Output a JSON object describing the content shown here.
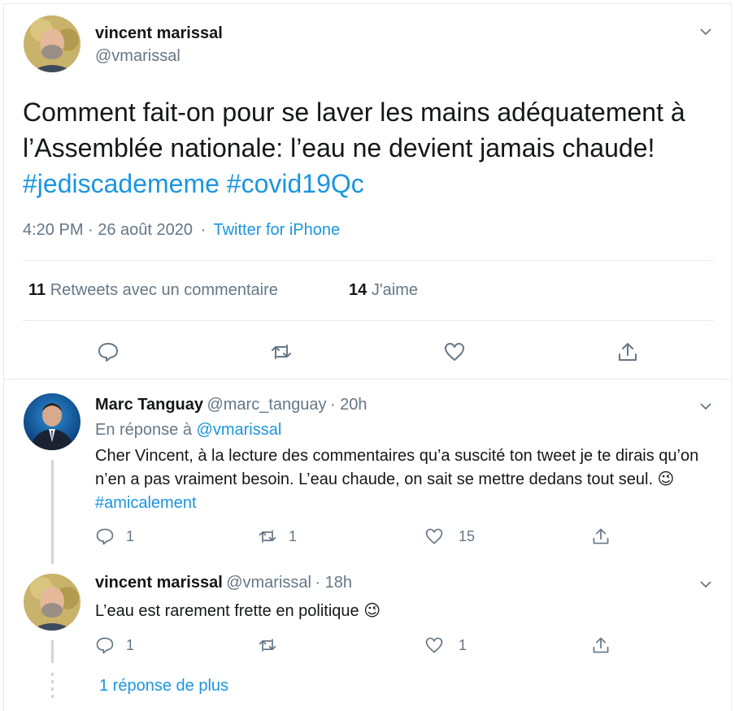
{
  "main_tweet": {
    "name": "vincent marissal",
    "handle": "@vmarissal",
    "text_plain": "Comment fait-on pour se laver les mains adéquatement à l’Assemblée nationale: l’eau ne devient jamais chaude! ",
    "hashtags": [
      "#jediscadememe",
      "#covid19Qc"
    ],
    "timestamp": "4:20 PM · 26 août 2020",
    "separator": "·",
    "source": "Twitter for iPhone",
    "retweet_count": "11",
    "retweet_label": "Retweets avec un commentaire",
    "like_count": "14",
    "like_label": "J'aime"
  },
  "reply1": {
    "name": "Marc Tanguay",
    "handle": "@marc_tanguay",
    "time": "· 20h",
    "reply_prefix": "En réponse à",
    "reply_to": "@vmarissal",
    "text": "Cher Vincent, à la lecture des commentaires qu’a suscité ton tweet je te dirais qu’on n’en a pas vraiment besoin. L’eau chaude, on sait se mettre dedans tout seul. 😉",
    "hashtag": "#amicalement",
    "reply_count": "1",
    "retweet_count": "1",
    "like_count": "15"
  },
  "reply2": {
    "name": "vincent marissal",
    "handle": "@vmarissal",
    "time": "· 18h",
    "text": "L’eau est rarement frette en politique 😉",
    "reply_count": "1",
    "like_count": "1"
  },
  "more_replies": "1 réponse de plus",
  "colors": {
    "link": "#1b95e0",
    "muted": "#657786",
    "divider": "#e6ecf0"
  }
}
